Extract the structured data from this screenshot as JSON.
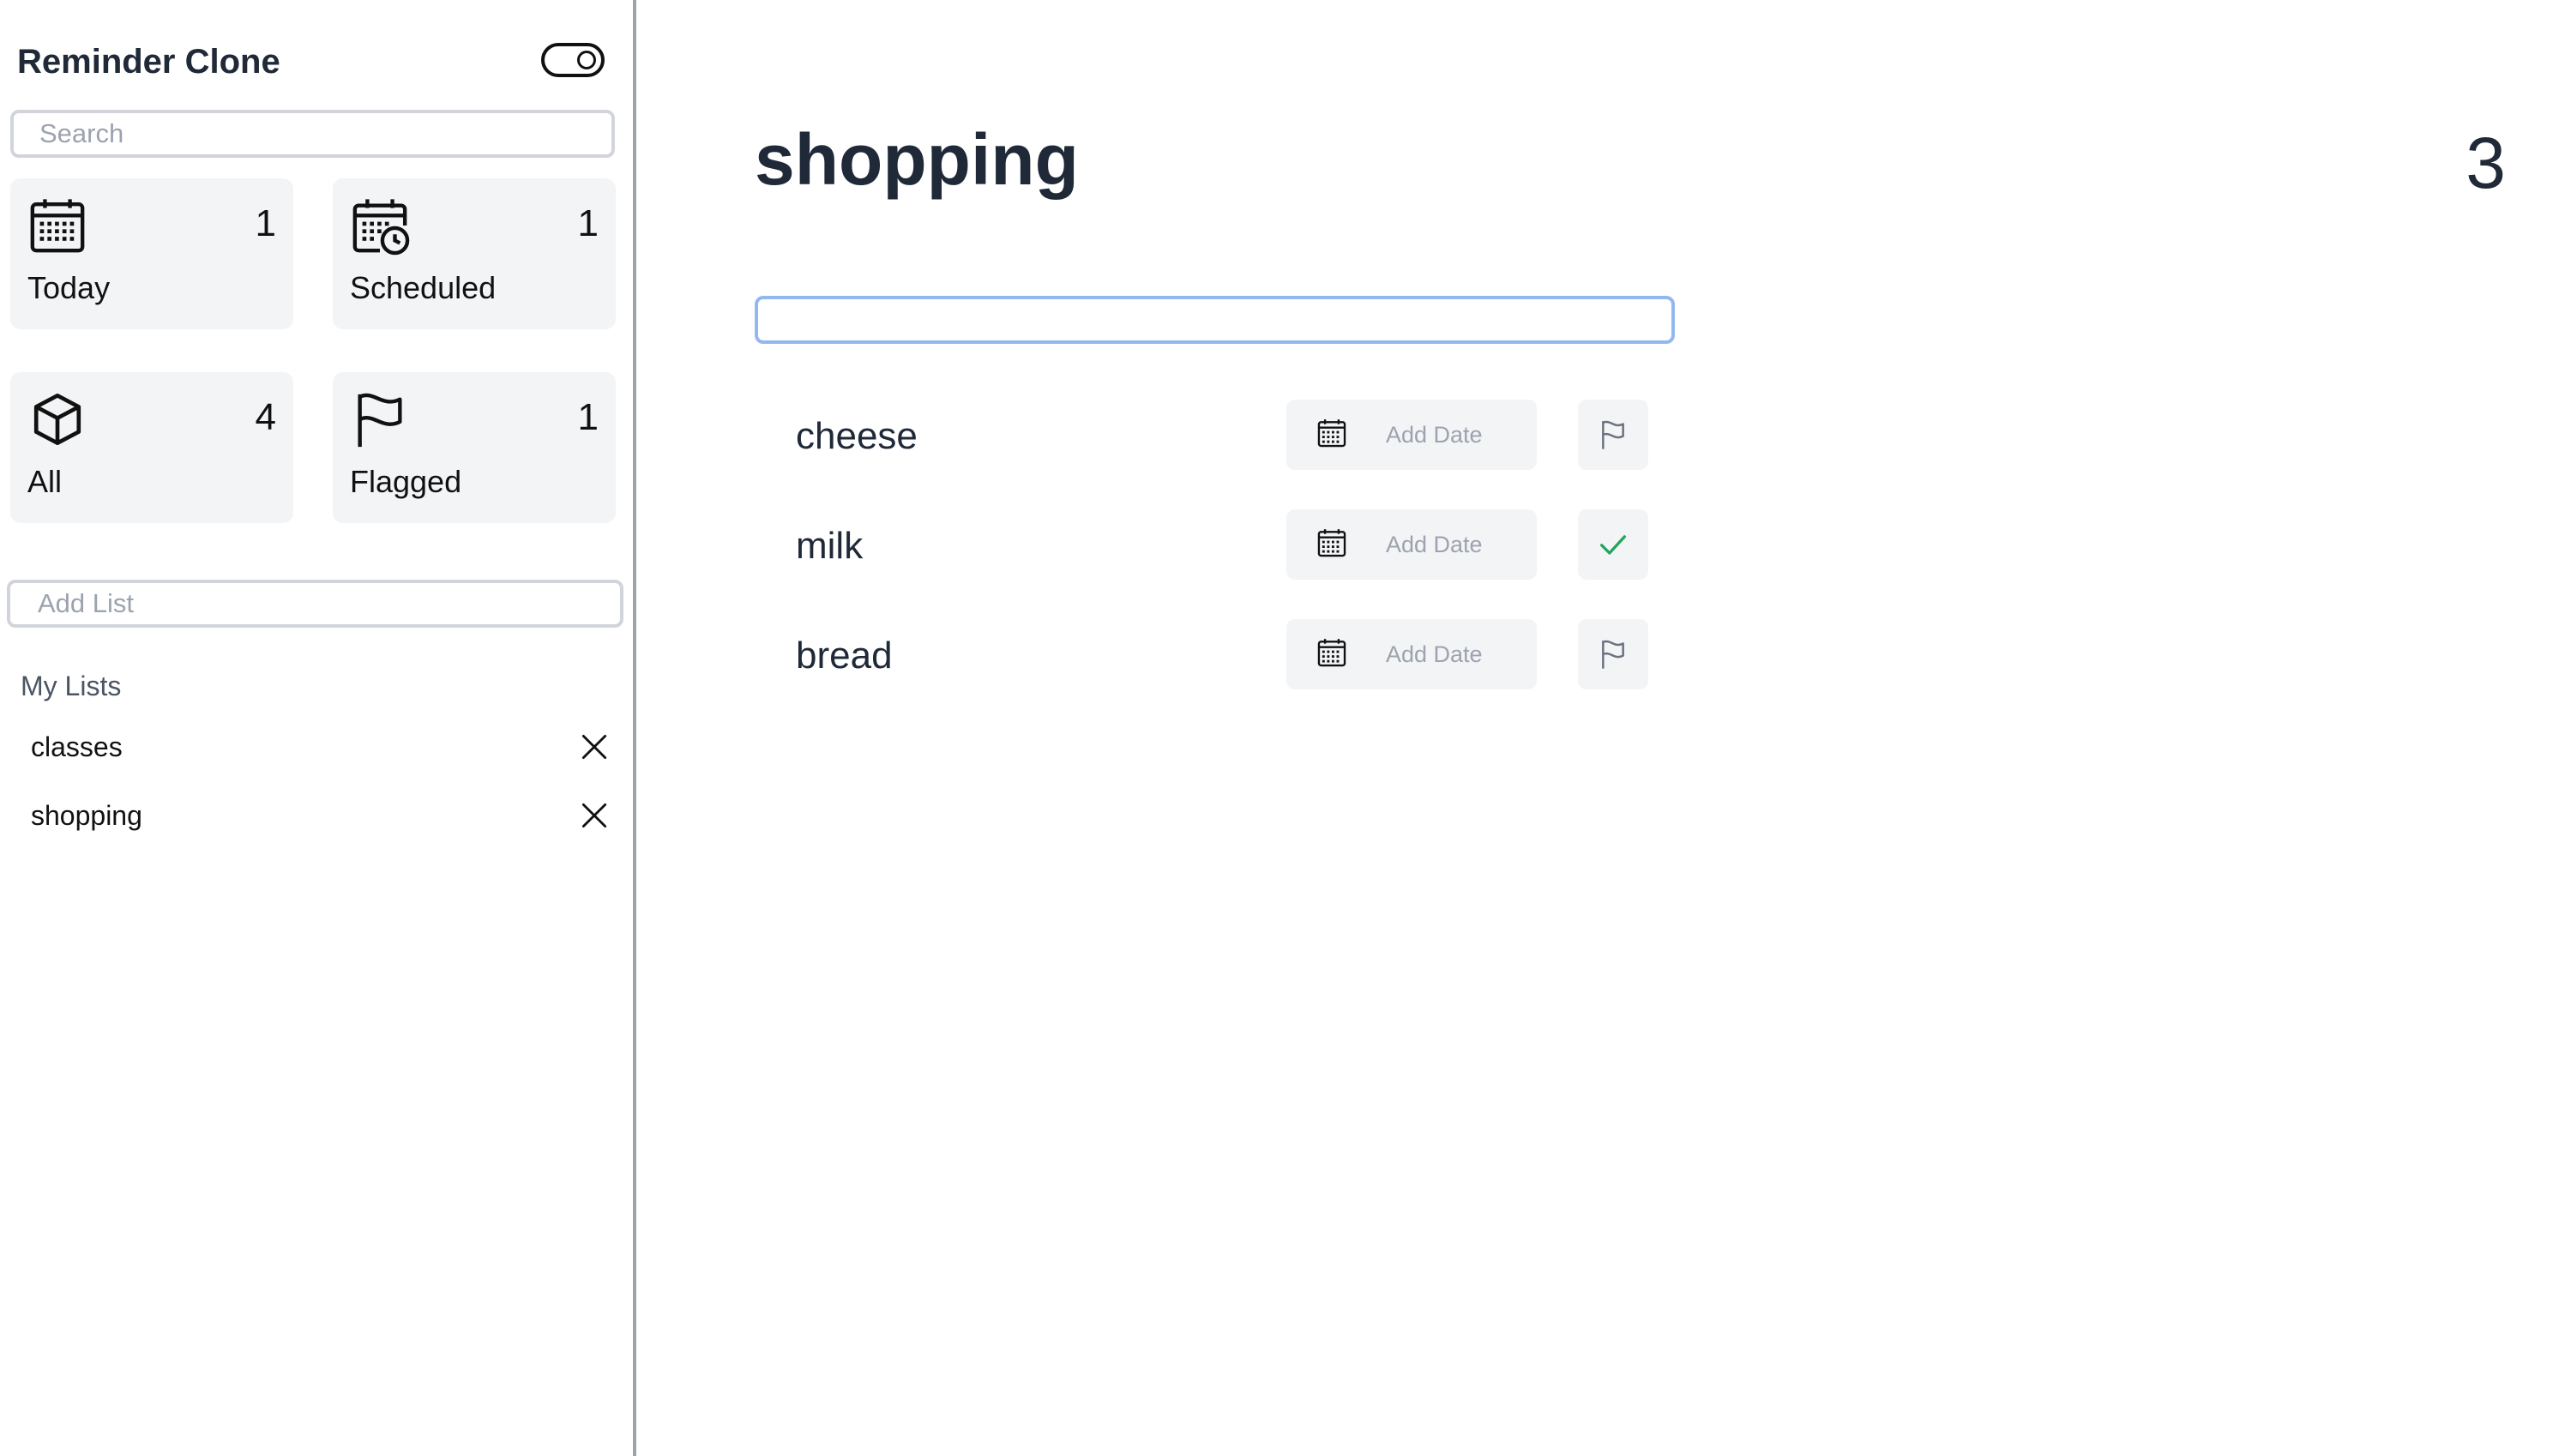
{
  "app": {
    "title": "Reminder Clone"
  },
  "sidebar": {
    "search_placeholder": "Search",
    "cards": [
      {
        "label": "Today",
        "count": "1",
        "icon": "calendar-icon"
      },
      {
        "label": "Scheduled",
        "count": "1",
        "icon": "calendar-clock-icon"
      },
      {
        "label": "All",
        "count": "4",
        "icon": "box-icon"
      },
      {
        "label": "Flagged",
        "count": "1",
        "icon": "flag-icon"
      }
    ],
    "add_list_placeholder": "Add List",
    "my_lists_heading": "My Lists",
    "lists": [
      {
        "label": "classes"
      },
      {
        "label": "shopping"
      }
    ]
  },
  "main": {
    "title": "shopping",
    "count": "3",
    "new_item_value": "",
    "items": [
      {
        "label": "cheese",
        "date_label": "Add Date",
        "flag_icon": "flag-outline-icon"
      },
      {
        "label": "milk",
        "date_label": "Add Date",
        "flag_icon": "check-icon"
      },
      {
        "label": "bread",
        "date_label": "Add Date",
        "flag_icon": "flag-outline-icon"
      }
    ]
  },
  "colors": {
    "card_bg": "#f3f4f6",
    "border": "#d1d5db",
    "focus_border": "#93b8f0",
    "check": "#22a55e",
    "divider": "#9ca3af"
  }
}
